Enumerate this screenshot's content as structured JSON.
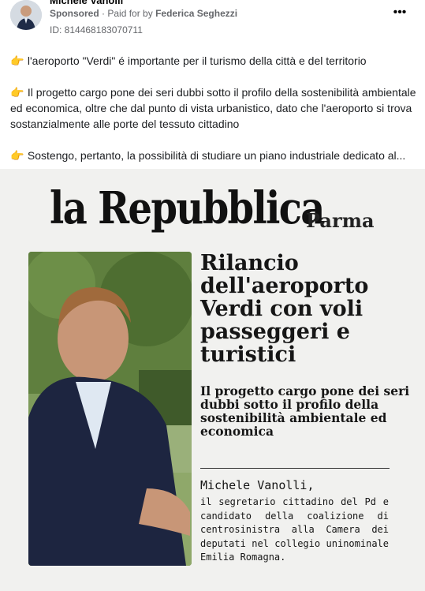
{
  "post": {
    "author": "Michele Vanolli",
    "sponsored_label": "Sponsored",
    "paid_prefix": "· Paid for by",
    "paid_by": "Federica Seghezzi",
    "id_line": "ID: 814468183070711",
    "more_icon": "more-horizontal-icon"
  },
  "body": {
    "paragraphs": [
      "l'aeroporto \"Verdi\" é importante per il turismo della città e del territorio",
      "Il progetto cargo pone dei seri dubbi sotto il profilo della sostenibilità ambientale ed economica, oltre che dal punto di vista urbanistico, dato che l'aeroporto si trova sostanzialmente alle porte del tessuto cittadino",
      "Sostengo, pertanto, la possibilità di studiare un piano industriale dedicato al..."
    ],
    "emoji": "👉"
  },
  "creative": {
    "masthead": "la Repubblica",
    "city": "Parma",
    "headline": "Rilancio dell'aeroporto Verdi con voli passeggeri e turistici",
    "subhead": "Il progetto cargo pone dei seri dubbi sotto il profilo della sostenibilità ambientale ed economica",
    "byline_name": "Michele Vanolli,",
    "byline_bio": "il segretario cittadino del Pd e candidato della coalizione di centrosinistra alla Camera dei deputati nel collegio uninominale Emilia Romagna."
  }
}
